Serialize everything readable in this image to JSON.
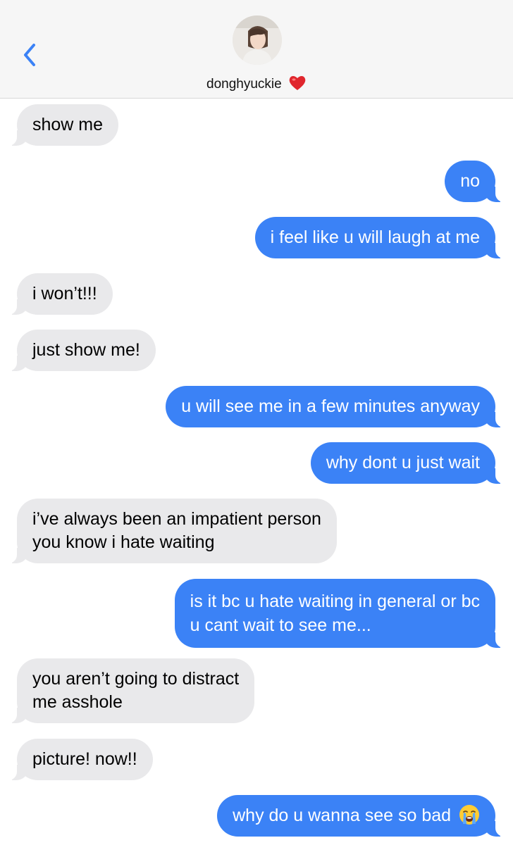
{
  "header": {
    "contact_name": "donghyuckie",
    "heart_icon": "red-heart-emoji",
    "back_icon": "chevron-left-icon",
    "accent_color": "#3b82f6"
  },
  "messages": [
    {
      "direction": "incoming",
      "lines": [
        "show me"
      ]
    },
    {
      "direction": "outgoing",
      "lines": [
        "no"
      ]
    },
    {
      "direction": "outgoing",
      "lines": [
        "i feel like u will laugh at me"
      ]
    },
    {
      "direction": "incoming",
      "lines": [
        "i won’t!!!"
      ]
    },
    {
      "direction": "incoming",
      "lines": [
        "just show me!"
      ]
    },
    {
      "direction": "outgoing",
      "lines": [
        "u will see me in a few minutes anyway"
      ]
    },
    {
      "direction": "outgoing",
      "lines": [
        "why dont u just wait"
      ]
    },
    {
      "direction": "incoming",
      "lines": [
        "i’ve always been an impatient person",
        "you know i hate waiting"
      ]
    },
    {
      "direction": "outgoing",
      "lines": [
        "is it bc u hate waiting in general or bc",
        "u cant wait to see me..."
      ]
    },
    {
      "direction": "incoming",
      "lines": [
        "you aren’t going to distract",
        "me asshole"
      ]
    },
    {
      "direction": "incoming",
      "lines": [
        "picture! now!!"
      ]
    },
    {
      "direction": "outgoing",
      "lines": [
        "why do u wanna see so bad"
      ],
      "emoji": "loudly-crying-face-emoji"
    }
  ],
  "colors": {
    "incoming_bubble": "#e9e9eb",
    "outgoing_bubble": "#3b82f6",
    "header_bg": "#f6f6f6"
  }
}
